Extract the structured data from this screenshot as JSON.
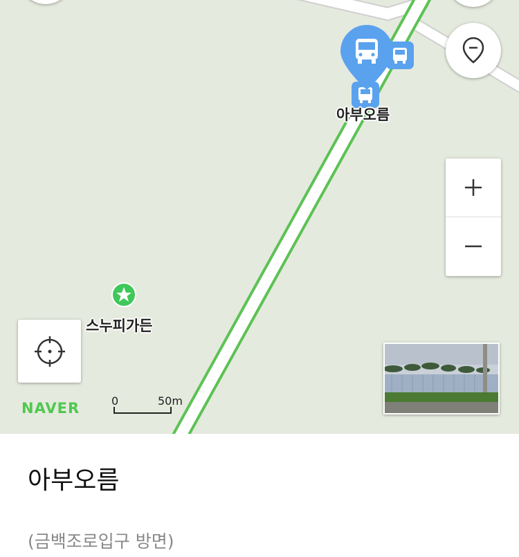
{
  "map": {
    "bus_stop_label": "아부오름",
    "poi_label": "스누피가든",
    "logo": "NAVER",
    "scale": {
      "left": "0",
      "right": "50m"
    },
    "zoom_in_symbol": "+",
    "zoom_out_symbol": "−",
    "icons": {
      "bus_pin": "bus-marker-icon",
      "bus_stop": "bus-stop-icon",
      "star": "star-icon",
      "location_pin": "location-pin-icon",
      "gps": "crosshair-icon"
    },
    "colors": {
      "background": "#e5eade",
      "road_line": "#5cc254",
      "bus_marker": "#5aa2ee",
      "poi_marker": "#3ec85a",
      "logo": "#4fc84f"
    }
  },
  "sheet": {
    "title": "아부오름",
    "subtitle": "(금백조로입구 방면)"
  }
}
